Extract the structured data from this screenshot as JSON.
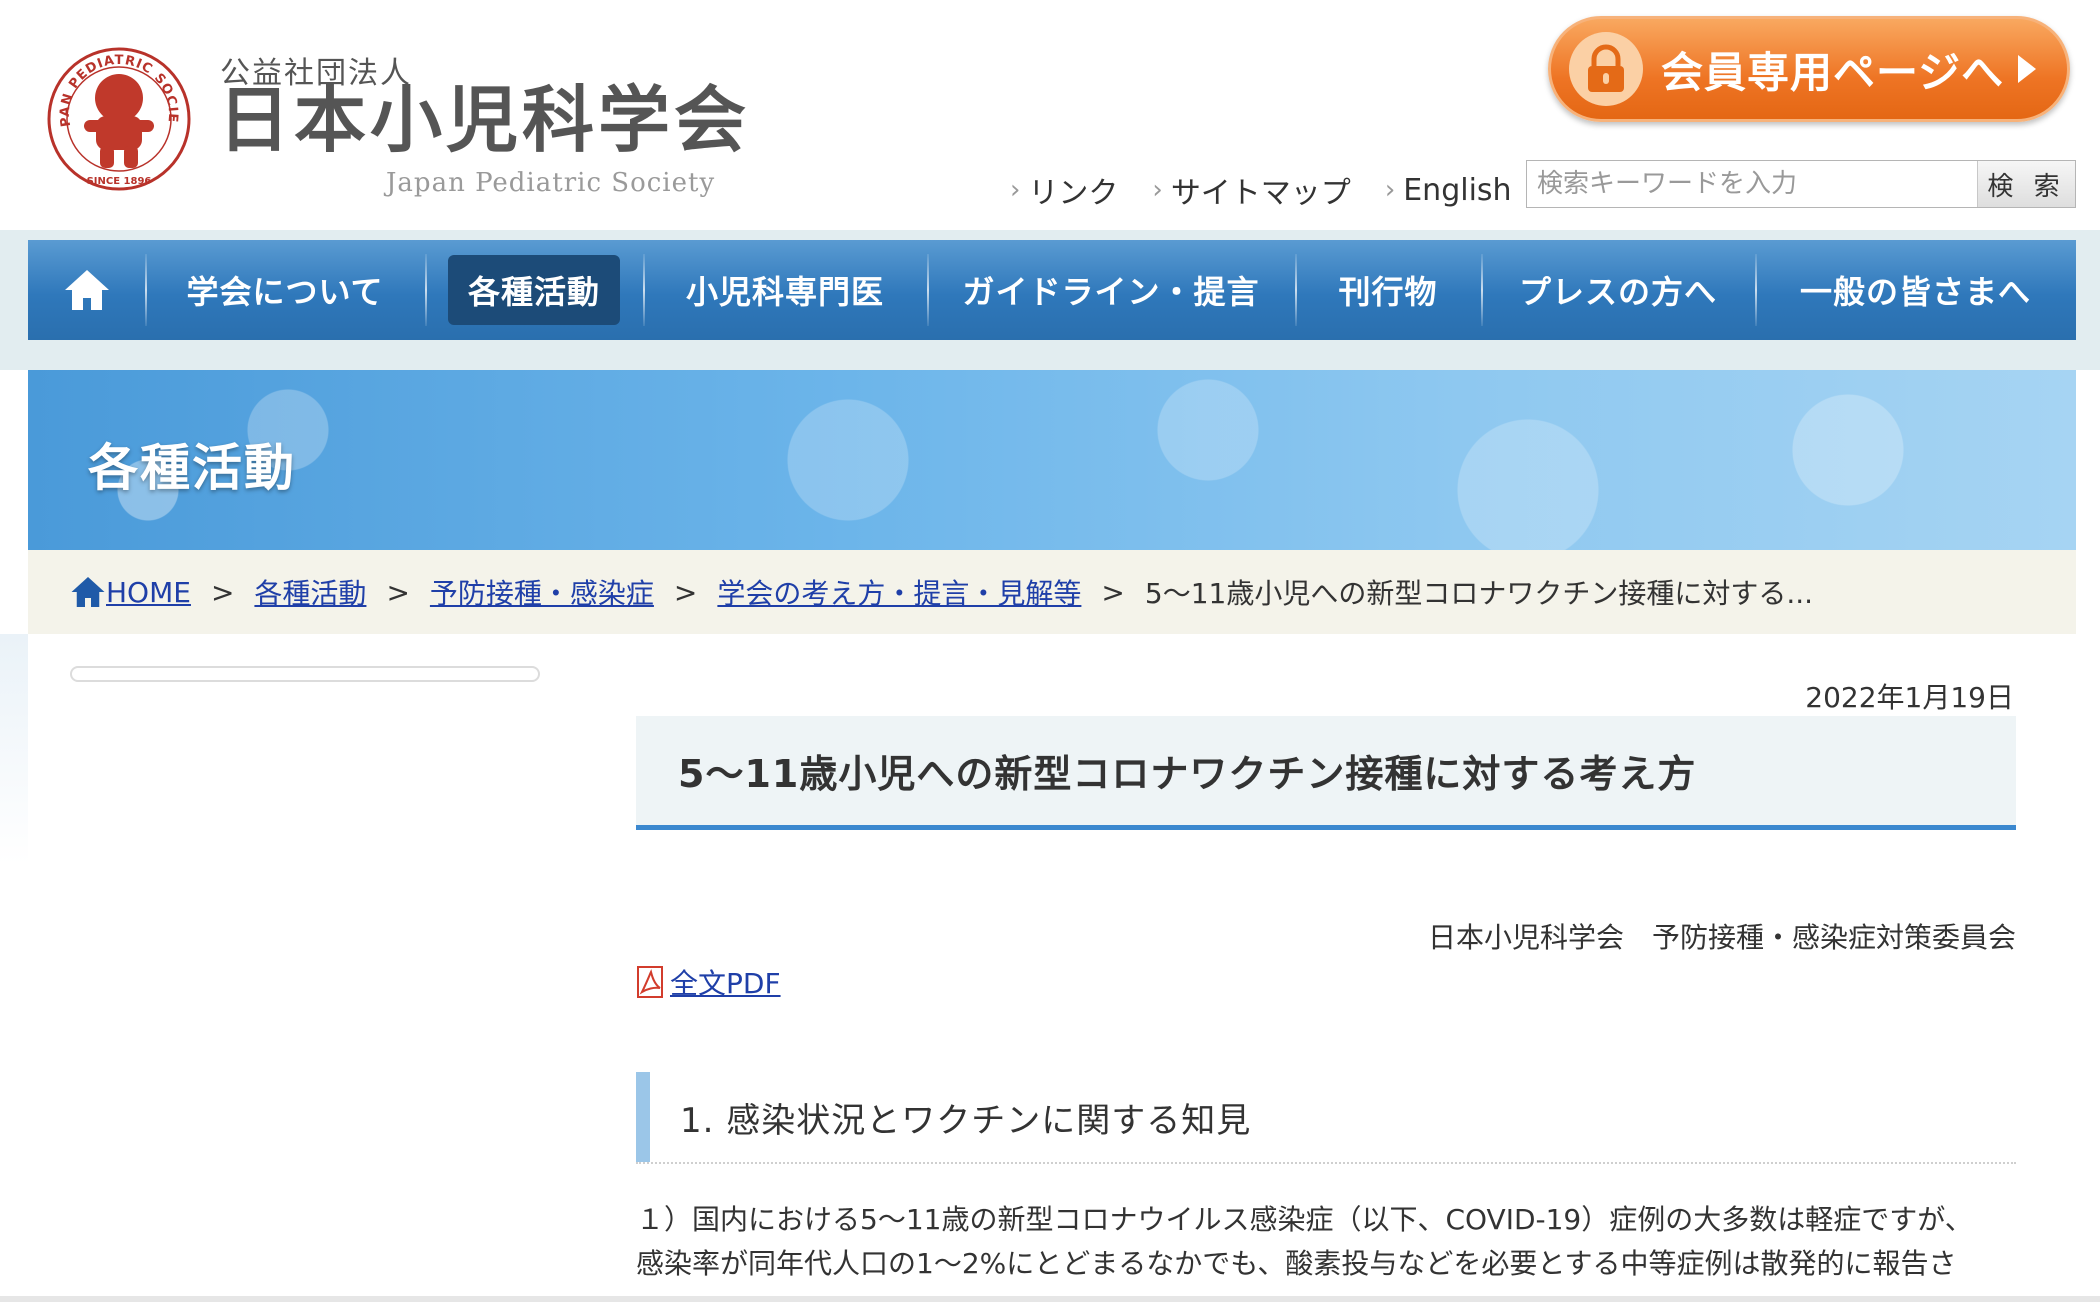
{
  "header": {
    "logo_text": {
      "sub": "公益社団法人",
      "main": "日本小児科学会",
      "en": "Japan Pediatric Society"
    },
    "seal_text": {
      "arc": "JAPAN PEDIATRIC SOCIETY",
      "since": "SINCE 1896"
    },
    "member_button": "会員専用ページへ",
    "util_links": [
      {
        "label": "リンク"
      },
      {
        "label": "サイトマップ"
      },
      {
        "label": "English"
      }
    ],
    "search": {
      "placeholder": "検索キーワードを入力",
      "button": "検 索"
    }
  },
  "nav": {
    "items": [
      {
        "label": "学会について"
      },
      {
        "label": "各種活動"
      },
      {
        "label": "小児科専門医"
      },
      {
        "label": "ガイドライン・提言"
      },
      {
        "label": "刊行物"
      },
      {
        "label": "プレスの方へ"
      },
      {
        "label": "一般の皆さまへ"
      }
    ],
    "active_index": 1
  },
  "hero": {
    "title": "各種活動"
  },
  "breadcrumb": {
    "items": [
      "HOME",
      "各種活動",
      "予防接種・感染症",
      "学会の考え方・提言・見解等"
    ],
    "separator": ">",
    "current": "5〜11歳小児への新型コロナワクチン接種に対する..."
  },
  "article": {
    "date": "2022年1月19日",
    "title": "5〜11歳小児への新型コロナワクチン接種に対する考え方",
    "committee": "日本小児科学会　予防接種・感染症対策委員会",
    "pdf_label": "全文PDF",
    "section1_title": "1. 感染状況とワクチンに関する知見",
    "paragraph_lines": [
      "１）国内における5〜11歳の新型コロナウイルス感染症（以下、COVID-19）症例の大多数は軽症ですが、",
      "感染率が同年代人口の1〜2%にとどまるなかでも、酸素投与などを必要とする中等症例は散発的に報告さ"
    ]
  },
  "colors": {
    "nav_blue": "#2f78bb",
    "member_orange": "#ee7424",
    "link_blue": "#1f3fa8",
    "title_underline": "#3b88cf",
    "logo_red": "#c0392b"
  }
}
